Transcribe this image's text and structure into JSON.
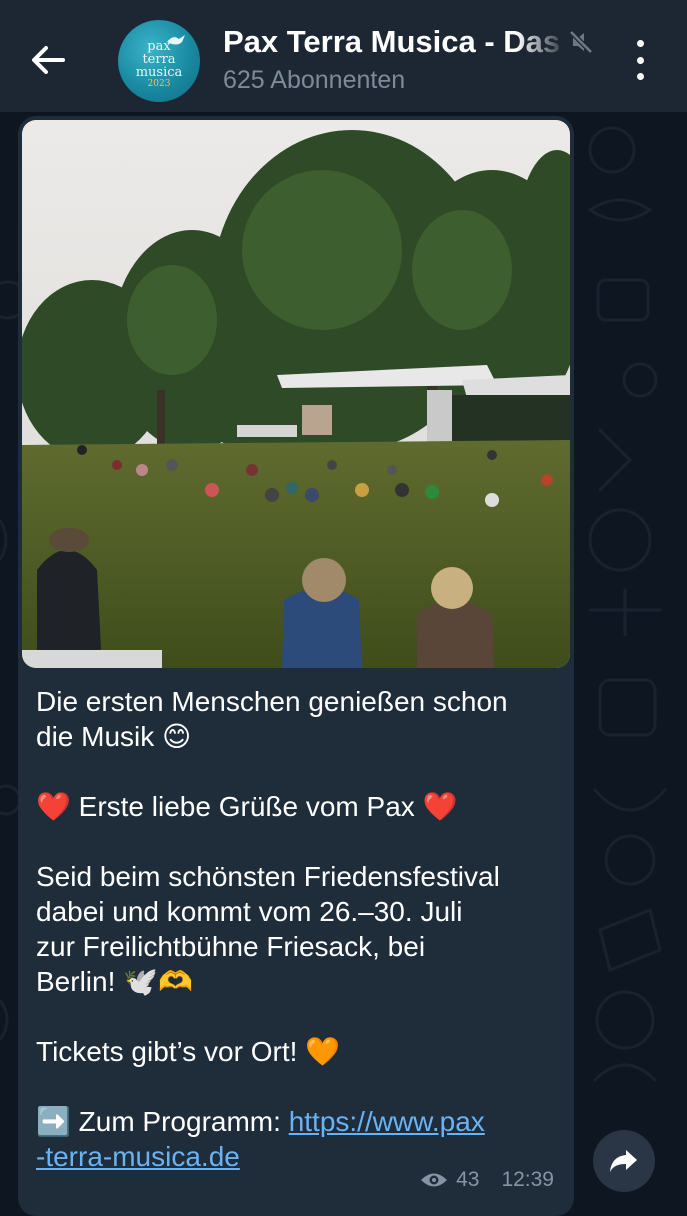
{
  "header": {
    "back_icon": "arrow-left-icon",
    "avatar_lines": [
      "pax",
      "terra",
      "musica",
      "2023"
    ],
    "title": "Pax Terra Musica - Das Friedensfestival",
    "subtitle": "625 Abonnenten",
    "mute_icon": "muted-speaker-icon",
    "menu_icon": "more-vertical-icon"
  },
  "message": {
    "photo_description_icon": "festival-photo",
    "line1": "Die ersten Menschen genießen schon",
    "line2": "die Musik 😊",
    "line3_heart_left": "❤️",
    "line3_text": " Erste liebe Grüße vom Pax ",
    "line3_heart_right": "❤️",
    "line4": "Seid beim schönsten Friedensfestival",
    "line5": "dabei und kommt vom 26.–30. Juli",
    "line6": "zur Freilichtbühne Friesack, bei",
    "line7": "Berlin! 🕊️🫶",
    "line8": "Tickets gibt’s vor Ort! 🧡",
    "line9_arrow": "➡️",
    "line9_text": " Zum Programm: ",
    "link_part1": "https://www.pax",
    "link_part2": "-terra-musica.de",
    "views": "43",
    "time": "12:39",
    "views_icon": "eye-icon"
  },
  "share_icon": "share-arrow-icon",
  "colors": {
    "background": "#0e1621",
    "header": "#1c2733",
    "bubble": "#1f2c3a",
    "link": "#6ab3f3",
    "meta": "#8595a5"
  }
}
